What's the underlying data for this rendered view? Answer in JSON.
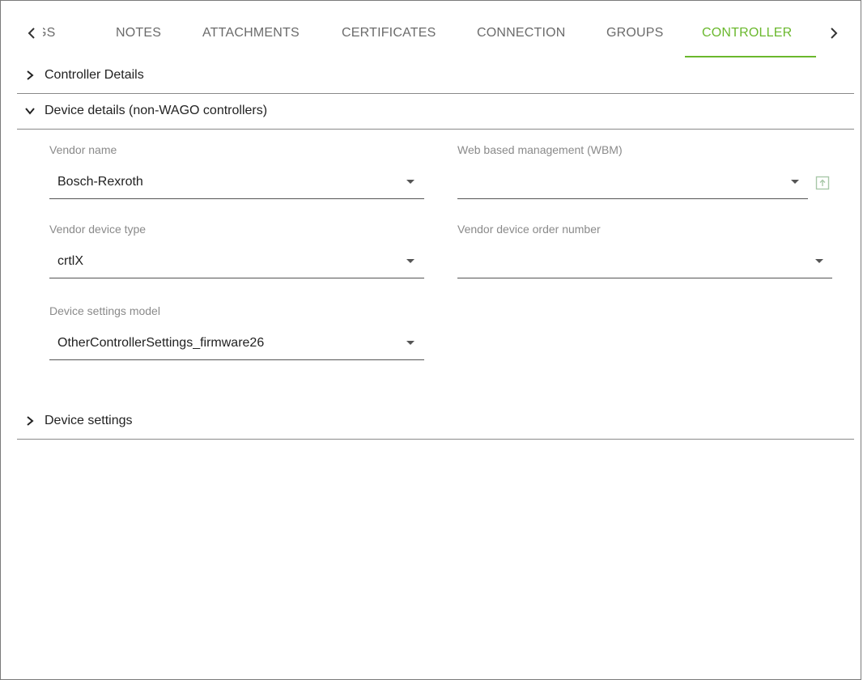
{
  "tabs": {
    "items": [
      {
        "label": "GS",
        "truncated": true
      },
      {
        "label": "NOTES"
      },
      {
        "label": "ATTACHMENTS"
      },
      {
        "label": "CERTIFICATES"
      },
      {
        "label": "CONNECTION"
      },
      {
        "label": "GROUPS"
      },
      {
        "label": "CONTROLLER",
        "active": true
      }
    ],
    "active_color": "#6ab82d",
    "prev_icon": "chevron-left-icon",
    "next_icon": "chevron-right-icon"
  },
  "sections": {
    "controller_details": {
      "label": "Controller Details",
      "expanded": false
    },
    "device_details": {
      "label": "Device details (non-WAGO controllers)",
      "expanded": true
    },
    "device_settings": {
      "label": "Device settings",
      "expanded": false
    }
  },
  "form": {
    "vendor_name": {
      "label": "Vendor name",
      "value": "Bosch-Rexroth"
    },
    "wbm": {
      "label": "Web based management (WBM)",
      "value": "",
      "action_icon": "open-in-new-icon"
    },
    "vendor_device_type": {
      "label": "Vendor device type",
      "value": "crtlX"
    },
    "vendor_device_order_number": {
      "label": "Vendor device order number",
      "value": ""
    },
    "device_settings_model": {
      "label": "Device settings model",
      "value": "OtherControllerSettings_firmware26"
    }
  }
}
